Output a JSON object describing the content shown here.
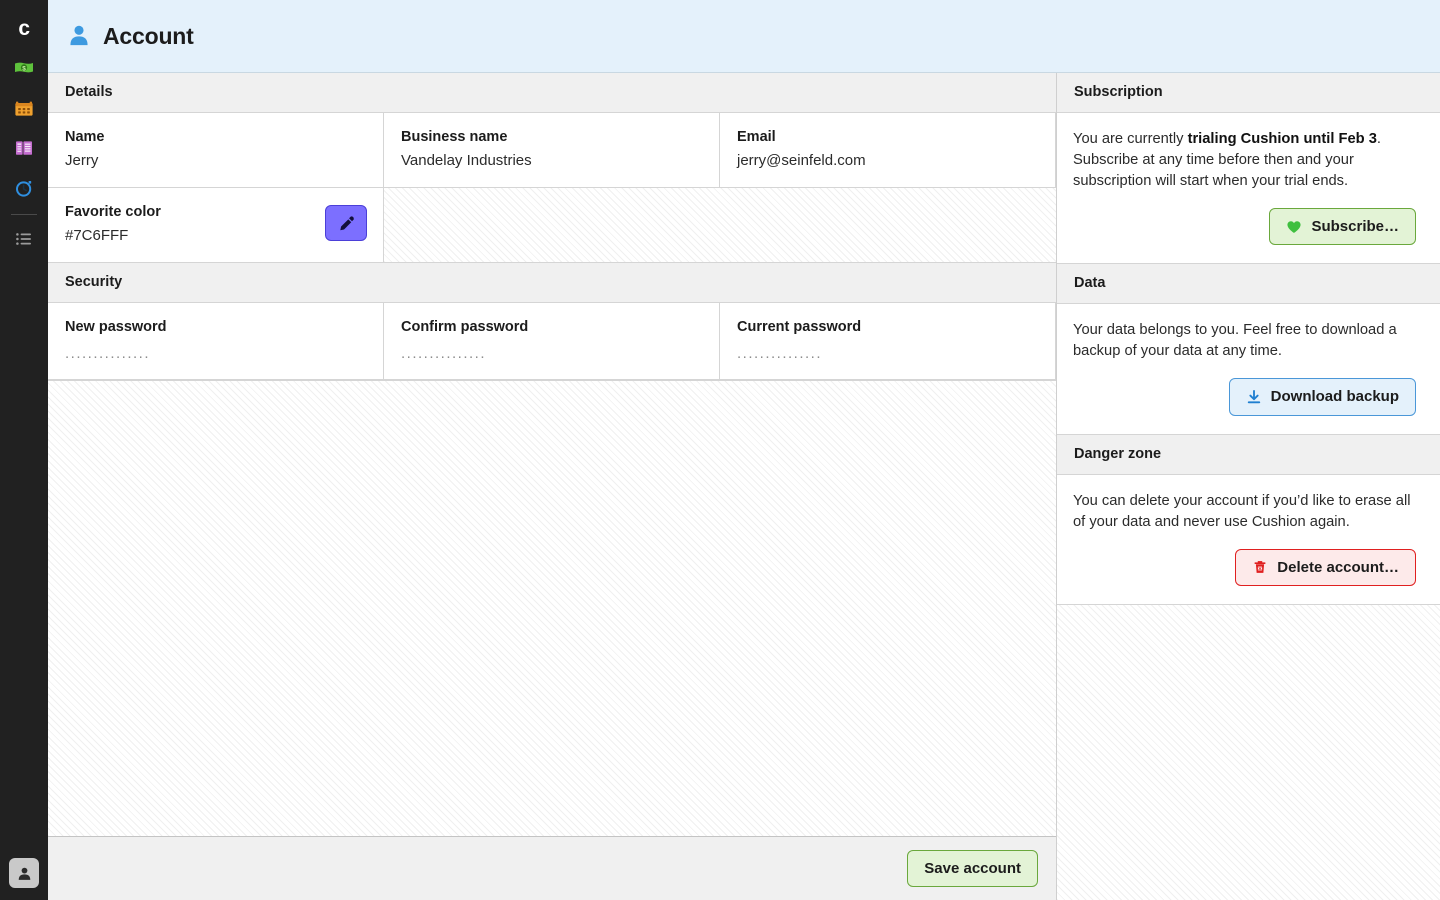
{
  "sidebar": {
    "logo_label": "c",
    "items": [
      {
        "name": "money-icon",
        "label": "Money"
      },
      {
        "name": "calendar-icon",
        "label": "Calendar"
      },
      {
        "name": "invoice-icon",
        "label": "Invoices"
      },
      {
        "name": "timer-icon",
        "label": "Time tracking"
      },
      {
        "name": "list-icon",
        "label": "List"
      }
    ],
    "avatar_label": "Account"
  },
  "header": {
    "title": "Account",
    "icon": "person-icon"
  },
  "details": {
    "section_title": "Details",
    "fields": [
      {
        "label": "Name",
        "value": "Jerry"
      },
      {
        "label": "Business name",
        "value": "Vandelay Industries"
      },
      {
        "label": "Email",
        "value": "jerry@seinfeld.com"
      }
    ],
    "favorite_color": {
      "label": "Favorite color",
      "value": "#7C6FFF",
      "swatch_color": "#7C6FFF",
      "picker_icon": "eyedropper-icon"
    }
  },
  "security": {
    "section_title": "Security",
    "fields": [
      {
        "label": "New password",
        "value": "...............",
        "placeholder": "New password"
      },
      {
        "label": "Confirm password",
        "value": "...............",
        "placeholder": "Confirm password"
      },
      {
        "label": "Current password",
        "value": "...............",
        "placeholder": "Current password"
      }
    ]
  },
  "subscription": {
    "section_title": "Subscription",
    "text_before": "You are currently ",
    "text_bold": "trialing Cushion until Feb 3",
    "text_after": ". Subscribe at any time before then and your subscription will start when your trial ends.",
    "button_label": "Subscribe…",
    "button_icon": "heart-icon"
  },
  "data_section": {
    "section_title": "Data",
    "text": "Your data belongs to you. Feel free to download a backup of your data at any time.",
    "button_label": "Download backup",
    "button_icon": "download-icon"
  },
  "danger": {
    "section_title": "Danger zone",
    "text": "You can delete your account if you’d like to erase all of your data and never use Cushion again.",
    "button_label": "Delete account…",
    "button_icon": "trash-icon"
  },
  "footer": {
    "save_label": "Save account"
  },
  "colors": {
    "header_bg": "#E4F1FB",
    "rail_bg": "#212121",
    "accent_purple": "#7C6FFF",
    "accent_green": "#6AA83C",
    "accent_blue": "#4A97D8",
    "accent_red": "#E02020"
  }
}
